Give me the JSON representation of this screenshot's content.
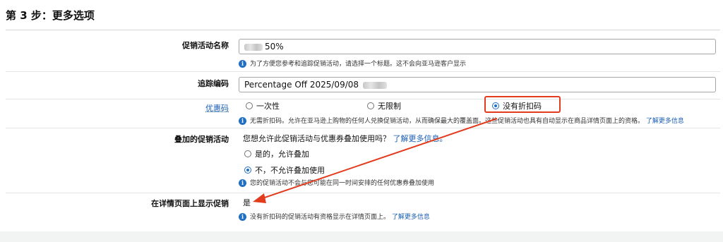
{
  "step_title": "第 3 步：更多选项",
  "promo_name": {
    "label": "促销活动名称",
    "value": "50%",
    "hint": "为了方便您参考和追踪促销活动，请选择一个标题。这不会向亚马逊客户显示"
  },
  "tracking_code": {
    "label": "追踪编码",
    "value": "Percentage Off 2025/09/08"
  },
  "coupon_code": {
    "label": "优惠码",
    "options": [
      "一次性",
      "无限制",
      "没有折扣码"
    ],
    "selected_index": 2,
    "hint": "无需折扣码。允许在亚马逊上购物的任何人兑换促销活动，从而确保最大的覆盖面。这些促销活动也具有自动显示在商品详情页面上的资格。",
    "learn_more": "了解更多信息"
  },
  "stacking": {
    "label": "叠加的促销活动",
    "question": "您想允许此促销活动与优惠券叠加使用吗？",
    "learn_more": "了解更多信息。",
    "options": [
      "是的，允许叠加",
      "不，不允许叠加使用"
    ],
    "selected_index": 1,
    "hint": "您的促销活动不会与您可能在同一时间安排的任何优惠券叠加使用"
  },
  "detail_display": {
    "label": "在详情页面上显示促销",
    "value": "是",
    "hint": "没有折扣码的促销活动有资格显示在详情页面上。",
    "learn_more": "了解更多信息"
  },
  "annotation_color": "#e23b1d",
  "accent_color": "#1f6fc4"
}
